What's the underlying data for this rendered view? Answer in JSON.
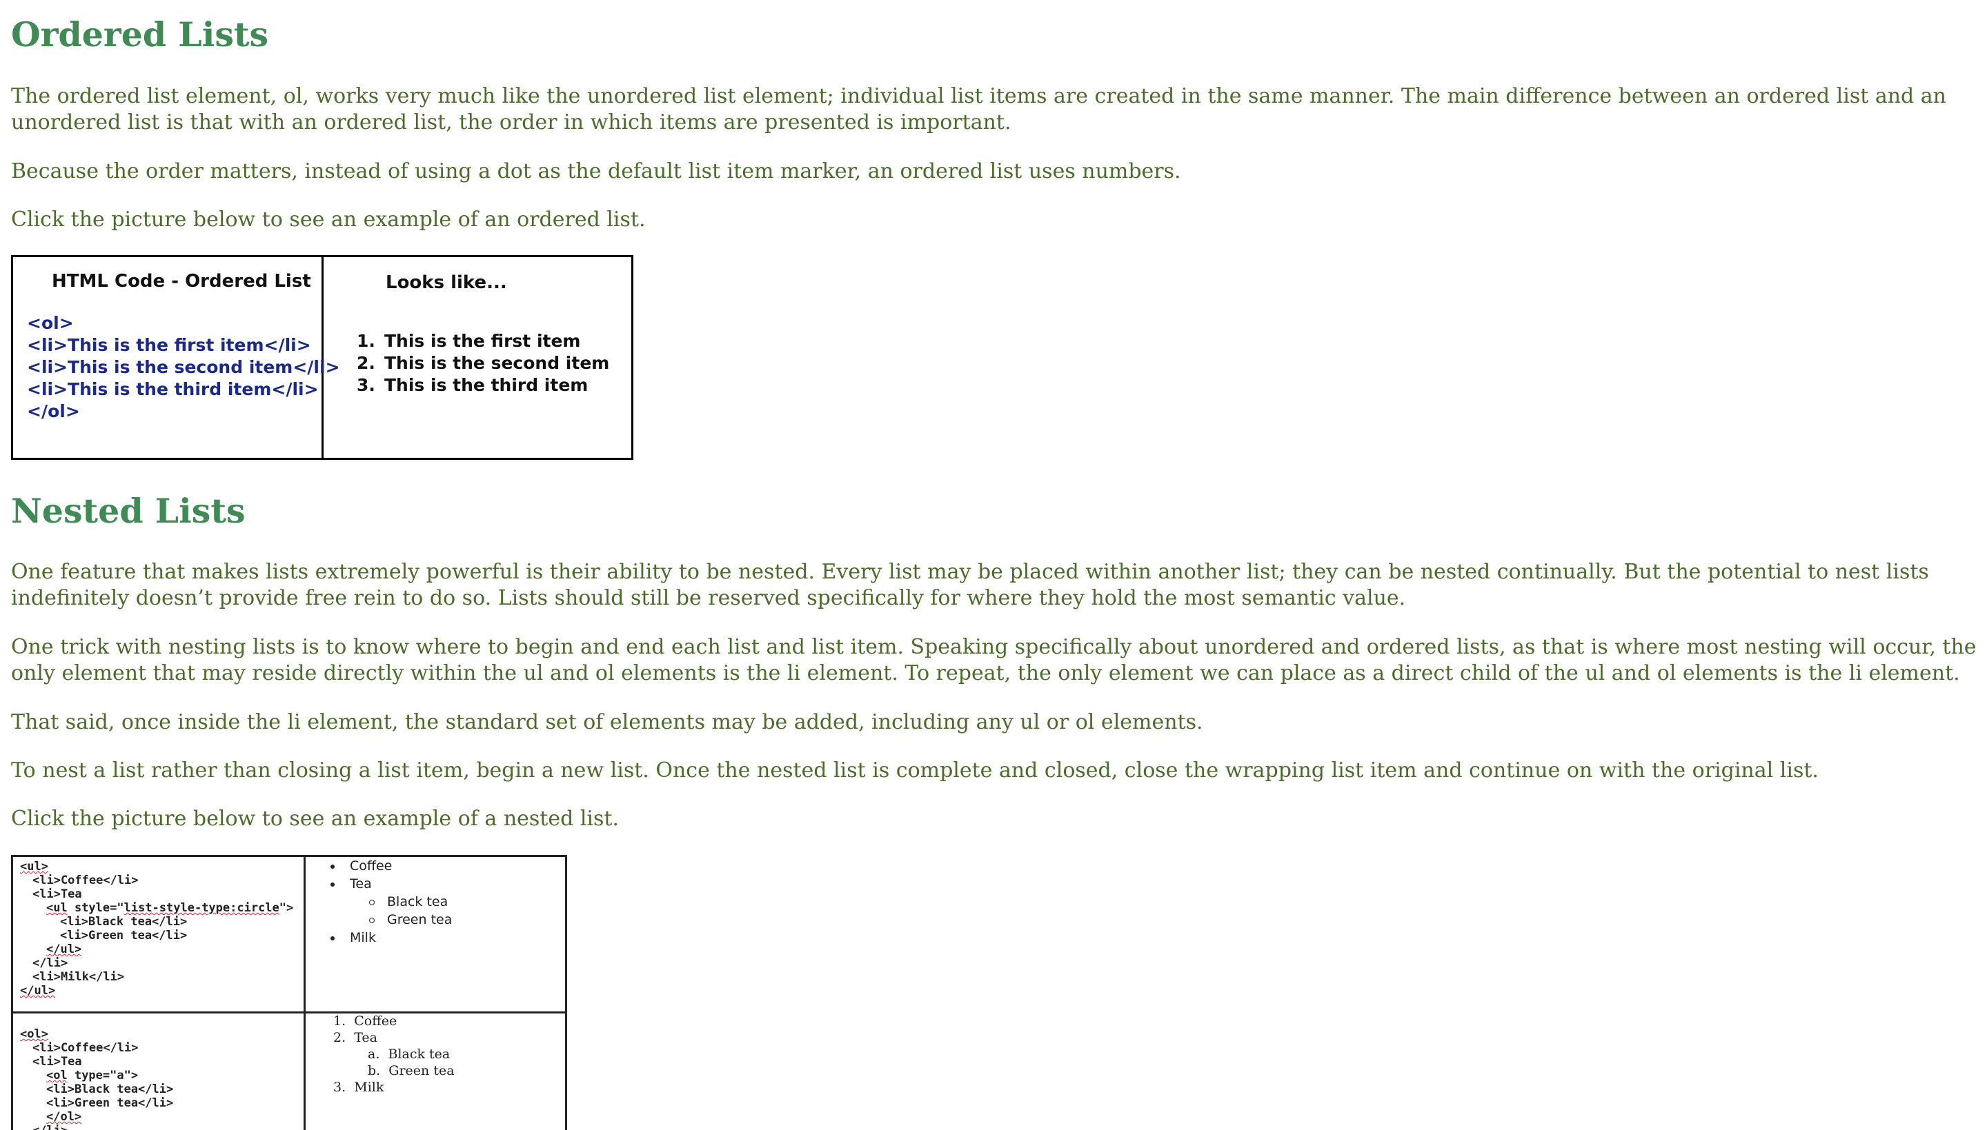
{
  "ordered_section": {
    "heading": "Ordered Lists",
    "paragraphs": [
      "The ordered list element, ol, works very much like the unordered list element; individual list items are created in the same manner. The main difference between an ordered list and an unordered list is that with an ordered list, the order in which items are presented is important.",
      "Because the order matters, instead of using a dot as the default list item marker, an ordered list uses numbers.",
      "Click the picture below to see an example of an ordered list."
    ],
    "figure": {
      "code_heading": "HTML Code - Ordered List",
      "code_lines": [
        "<ol>",
        "<li>This is the first item</li>",
        "<li>This is the second item</li>",
        "<li>This is the third item</li>",
        "</ol>"
      ],
      "preview_heading": "Looks like...",
      "preview_items": [
        {
          "num": "1.",
          "text": "This is the first item"
        },
        {
          "num": "2.",
          "text": "This is the second item"
        },
        {
          "num": "3.",
          "text": "This is the third item"
        }
      ]
    }
  },
  "nested_section": {
    "heading": "Nested Lists",
    "paragraphs": [
      "One feature that makes lists extremely powerful is their ability to be nested. Every list may be placed within another list; they can be nested continually. But the potential to nest lists indefinitely doesn’t provide free rein to do so. Lists should still be reserved specifically for where they hold the most semantic value.",
      "One trick with nesting lists is to know where to begin and end each list and list item. Speaking specifically about unordered and ordered lists, as that is where most nesting will occur, the only element that may reside directly within the ul and ol elements is the li element. To repeat, the only element we can place as a direct child of the ul and ol elements is the li element.",
      "That said, once inside the li element, the standard set of elements may be added, including any ul or ol elements.",
      "To nest a list rather than closing a list item, begin a new list. Once the nested list is complete and closed, close the wrapping list item and continue on with the original list.",
      "Click the picture below to see an example of a nested list."
    ],
    "figure": {
      "ul_code": {
        "open": "<ul>",
        "coffee": "<li>Coffee</li>",
        "tea": "<li>Tea",
        "inner_open_tag": "<ul",
        "inner_open_attr": " style=\"",
        "inner_open_value": "list-style-type:circle",
        "inner_open_end": "\">",
        "black": "<li>Black tea</li>",
        "green": "<li>Green tea</li>",
        "inner_close": "</ul>",
        "tea_close": "</li>",
        "milk": "<li>Milk</li>",
        "close": "</ul>"
      },
      "ul_render": {
        "coffee": "Coffee",
        "tea": "Tea",
        "black": "Black tea",
        "green": "Green tea",
        "milk": "Milk"
      },
      "ol_code": {
        "open": "<ol>",
        "coffee": "<li>Coffee</li>",
        "tea": "<li>Tea",
        "inner_open_tag": "<ol",
        "inner_open_rest": " type=\"a\">",
        "black": "<li>Black tea</li>",
        "green": "<li>Green tea</li>",
        "inner_close": "</ol>",
        "tea_close": "</li>"
      },
      "ol_render": [
        {
          "marker": "1.",
          "text": "Coffee"
        },
        {
          "marker": "2.",
          "text": "Tea"
        },
        {
          "marker": "a.",
          "text": "Black tea"
        },
        {
          "marker": "b.",
          "text": "Green tea"
        },
        {
          "marker": "3.",
          "text": "Milk"
        }
      ]
    }
  }
}
